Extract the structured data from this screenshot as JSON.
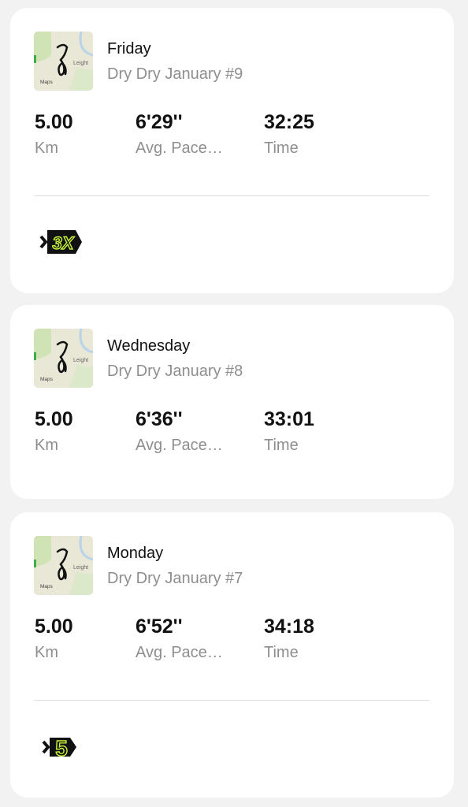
{
  "activities": [
    {
      "day": "Friday",
      "subtitle": "Dry Dry January #9",
      "map": {
        "place_label": "Leight",
        "maps_label": "Maps"
      },
      "stats": [
        {
          "value": "5.00",
          "label": "Km"
        },
        {
          "value": "6'29''",
          "label": "Avg. Pace…"
        },
        {
          "value": "32:25",
          "label": "Time"
        }
      ],
      "badge": {
        "icon": "3x-streak-badge-icon",
        "text": "3X",
        "color": "#c6f23a"
      }
    },
    {
      "day": "Wednesday",
      "subtitle": "Dry Dry January #8",
      "map": {
        "place_label": "Leight",
        "maps_label": "Maps"
      },
      "stats": [
        {
          "value": "5.00",
          "label": "Km"
        },
        {
          "value": "6'36''",
          "label": "Avg. Pace…"
        },
        {
          "value": "33:01",
          "label": "Time"
        }
      ]
    },
    {
      "day": "Monday",
      "subtitle": "Dry Dry January #7",
      "map": {
        "place_label": "Leight",
        "maps_label": "Maps"
      },
      "stats": [
        {
          "value": "5.00",
          "label": "Km"
        },
        {
          "value": "6'52''",
          "label": "Avg. Pace…"
        },
        {
          "value": "34:18",
          "label": "Time"
        }
      ],
      "badge": {
        "icon": "5-streak-badge-icon",
        "text": "5",
        "color": "#c6f23a"
      }
    }
  ]
}
